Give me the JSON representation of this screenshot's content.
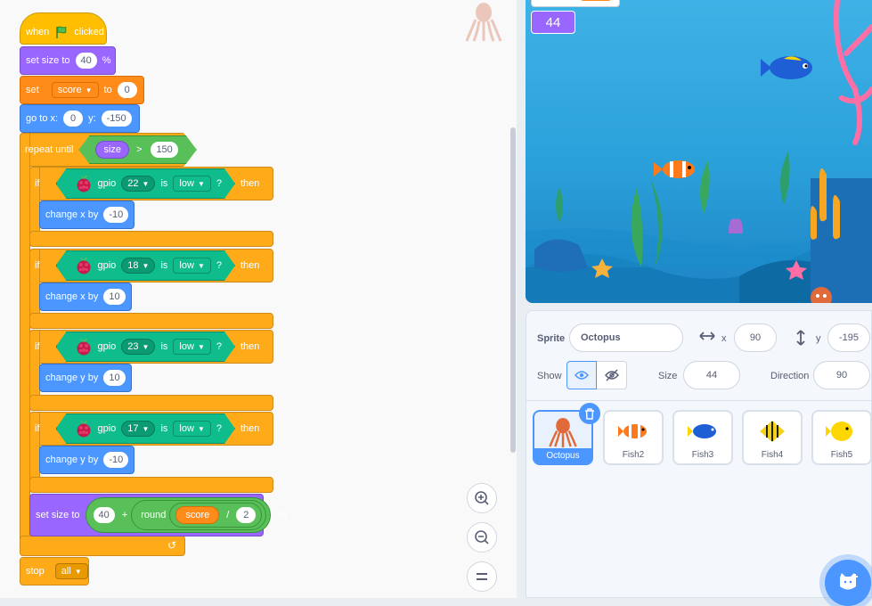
{
  "code": {
    "when_label": "when",
    "clicked_label": "clicked",
    "set_size_label": "set size to",
    "set_size_value": "40",
    "percent": "%",
    "set_label": "set",
    "set_var": "score",
    "to_label": "to",
    "set_value": "0",
    "goto_label": "go to x:",
    "goto_x": "0",
    "goto_y_label": "y:",
    "goto_y": "-150",
    "repeat_until_label": "repeat until",
    "size_reporter": "size",
    "gt": ">",
    "gt_value": "150",
    "if_label": "if",
    "then_label": "then",
    "gpio_label": "gpio",
    "is_label": "is",
    "q": "?",
    "ifs": [
      {
        "pin": "22",
        "state": "low",
        "action": "change x by",
        "value": "-10"
      },
      {
        "pin": "18",
        "state": "low",
        "action": "change x by",
        "value": "10"
      },
      {
        "pin": "23",
        "state": "low",
        "action": "change y by",
        "value": "10"
      },
      {
        "pin": "17",
        "state": "low",
        "action": "change y by",
        "value": "-10"
      }
    ],
    "final_set_size_label": "set size to",
    "final_a": "40",
    "plus": "+",
    "round_label": "round",
    "score_reporter": "score",
    "div": "/",
    "div_value": "2",
    "final_percent": "%",
    "stop_label": "stop",
    "stop_option": "all"
  },
  "stage": {
    "score_display": "44"
  },
  "sprite_info": {
    "sprite_label": "Sprite",
    "sprite_name": "Octopus",
    "x_label": "x",
    "x_value": "90",
    "y_label": "y",
    "y_value": "-195",
    "show_label": "Show",
    "size_label": "Size",
    "size_value": "44",
    "direction_label": "Direction",
    "direction_value": "90"
  },
  "sprites": [
    {
      "name": "Octopus",
      "color": "#e06a3a"
    },
    {
      "name": "Fish2",
      "color": "#ff7a1a"
    },
    {
      "name": "Fish3",
      "color": "#1f5fd6"
    },
    {
      "name": "Fish4",
      "color": "#f2d21b"
    },
    {
      "name": "Fish5",
      "color": "#ffd700"
    }
  ],
  "colors": {
    "events": "#ffbf00",
    "looks": "#9966ff",
    "variables": "#ff8c1a",
    "motion": "#4c97ff",
    "control": "#ffab19",
    "extension": "#0fbd8c",
    "operators": "#59c059"
  }
}
